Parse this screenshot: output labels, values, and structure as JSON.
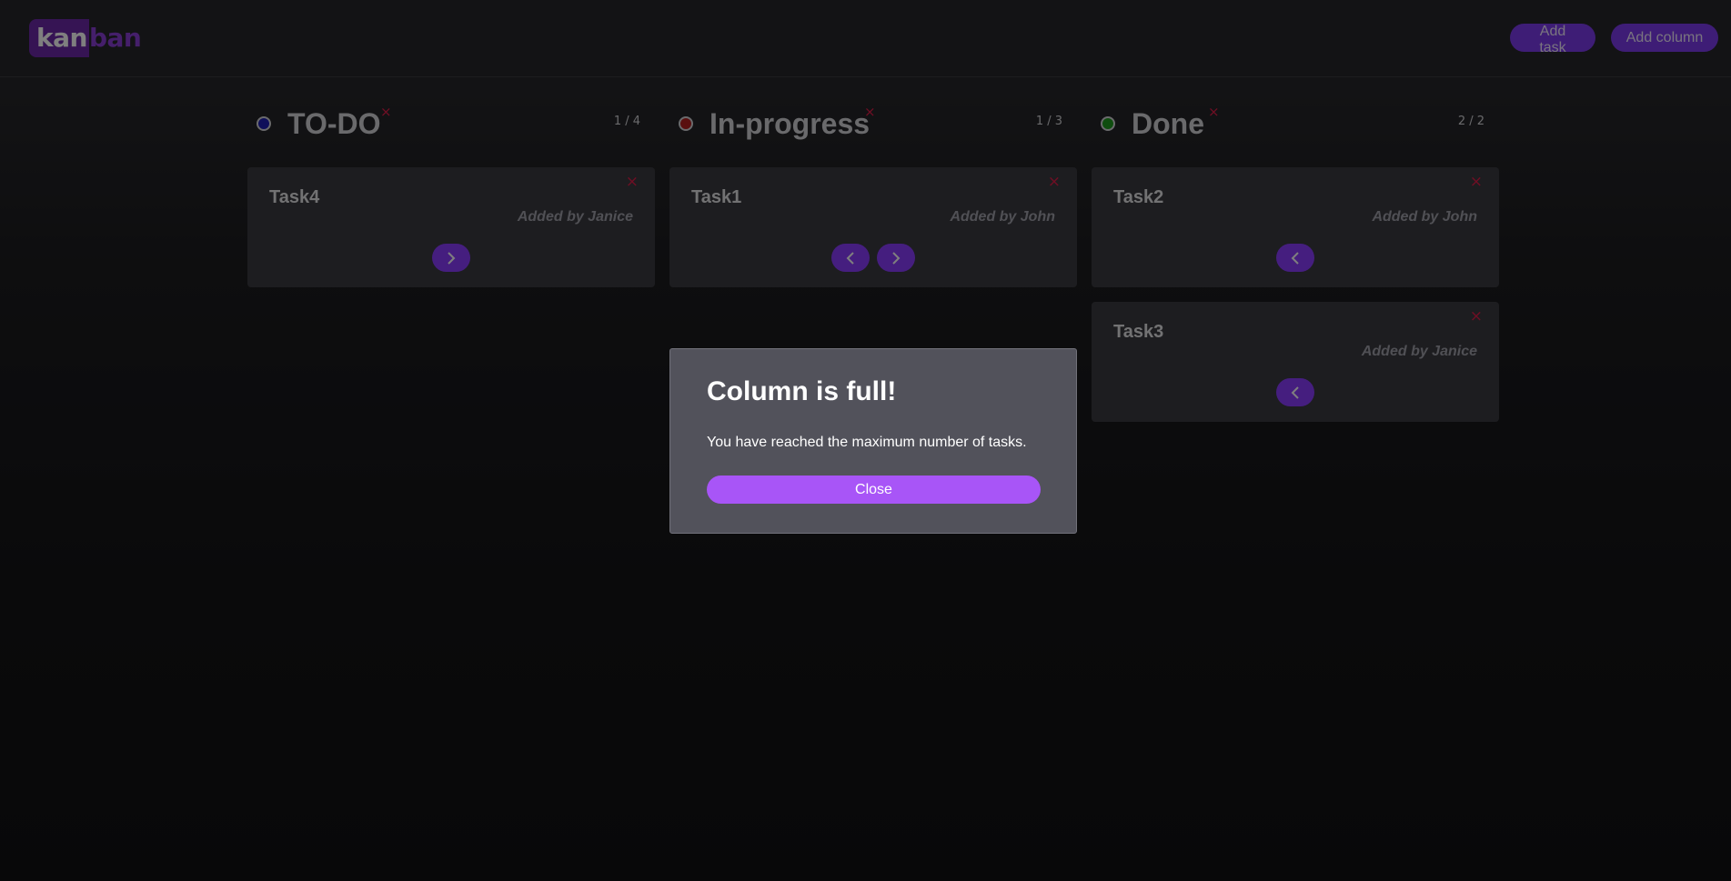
{
  "header": {
    "logo_part1": "kan",
    "logo_part2": "ban",
    "add_task_label": "Add task",
    "add_column_label": "Add column"
  },
  "columns": [
    {
      "title": "TO-DO",
      "dot_color": "#1e1eb4",
      "count": "1 / 4",
      "remove": "×",
      "tasks": [
        {
          "title": "Task4",
          "added_by": "Added by Janice",
          "remove": "×"
        }
      ]
    },
    {
      "title": "In-progress",
      "dot_color": "#b41e1e",
      "count": "1 / 3",
      "remove": "×",
      "tasks": [
        {
          "title": "Task1",
          "added_by": "Added by John",
          "remove": "×"
        }
      ]
    },
    {
      "title": "Done",
      "dot_color": "#1e9b1e",
      "count": "2 / 2",
      "remove": "×",
      "tasks": [
        {
          "title": "Task2",
          "added_by": "Added by John",
          "remove": "×"
        },
        {
          "title": "Task3",
          "added_by": "Added by Janice",
          "remove": "×"
        }
      ]
    }
  ],
  "modal": {
    "title": "Column is full!",
    "message": "You have reached the maximum number of tasks.",
    "close_label": "Close"
  },
  "colors": {
    "accent": "#a855f7",
    "remove": "#e11d48"
  }
}
